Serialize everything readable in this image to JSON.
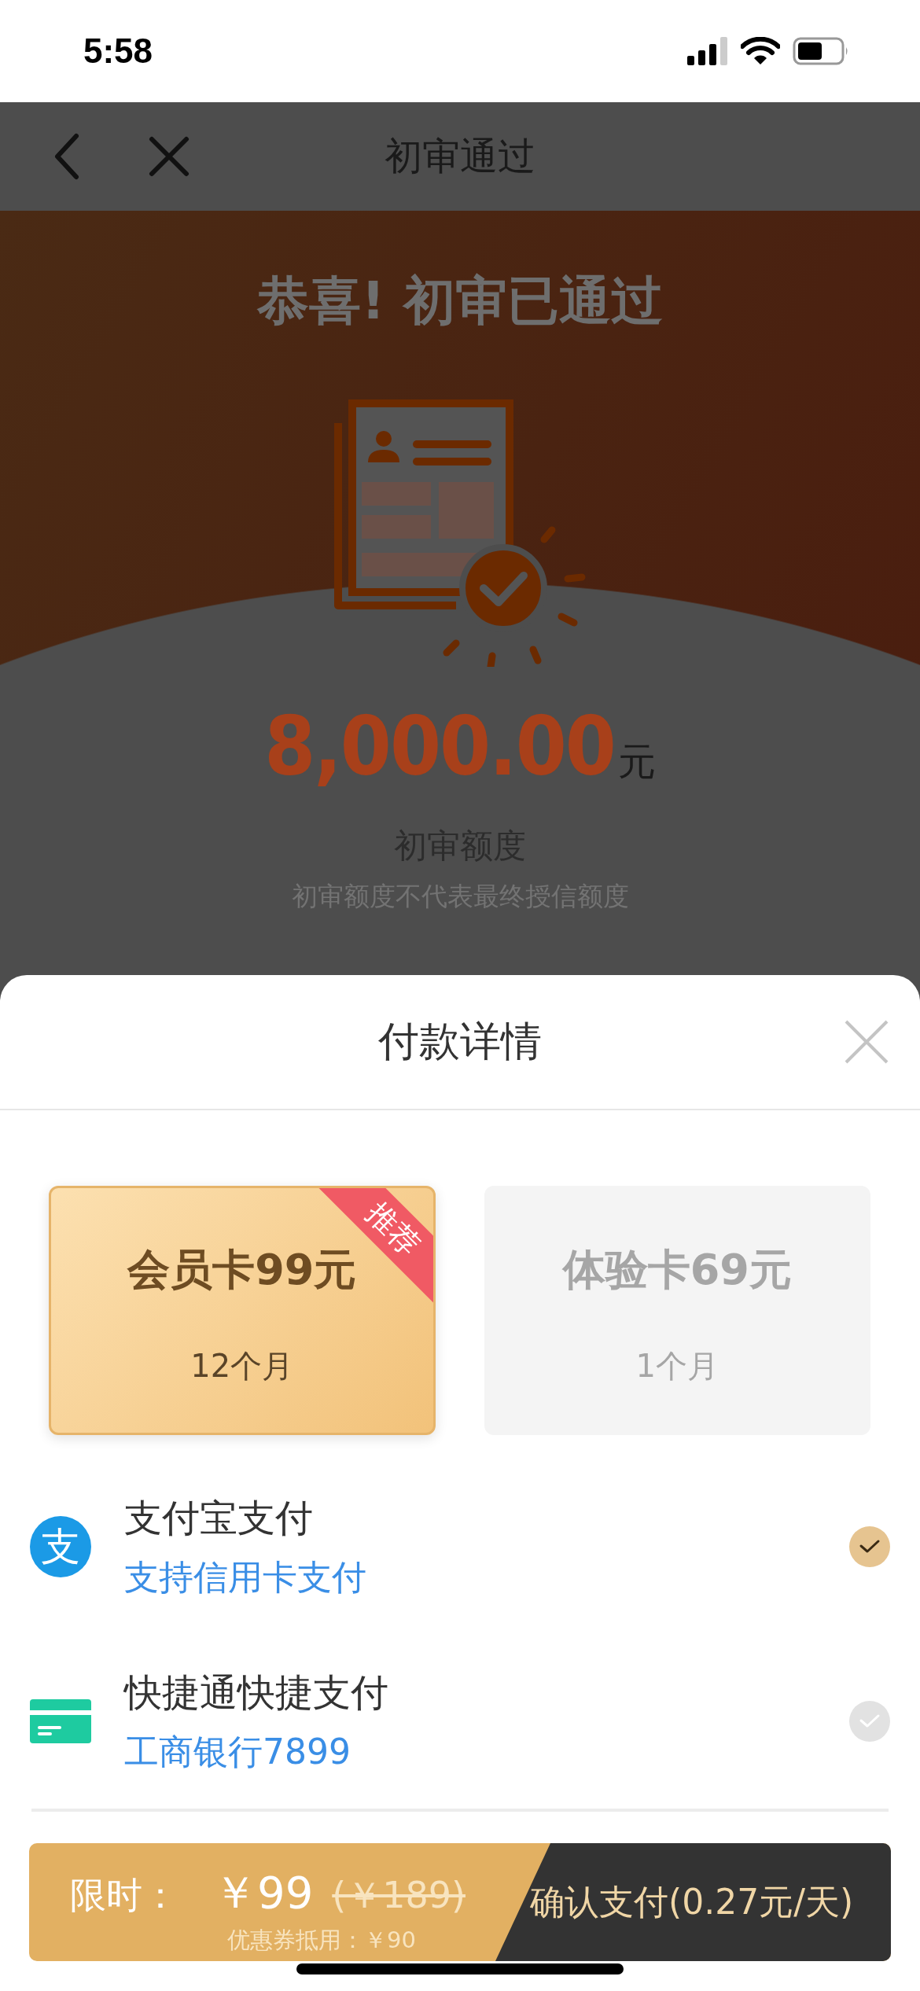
{
  "status_bar": {
    "time": "5:58"
  },
  "nav": {
    "title": "初审通过"
  },
  "hero": {
    "heading": "恭喜! 初审已通过",
    "amount": "8,000.00",
    "unit": "元",
    "label": "初审额度",
    "note": "初审额度不代表最终授信额度"
  },
  "sheet": {
    "title": "付款详情",
    "plans": [
      {
        "name": "会员卡99元",
        "period": "12个月",
        "selected": true,
        "badge": "推荐"
      },
      {
        "name": "体验卡69元",
        "period": "1个月",
        "selected": false
      }
    ],
    "payment_methods": [
      {
        "kind": "alipay",
        "logo_text": "支",
        "name": "支付宝支付",
        "detail": "支持信用卡支付",
        "selected": true
      },
      {
        "kind": "card",
        "name": "快捷通快捷支付",
        "detail": "工商银行7899",
        "selected": false
      }
    ]
  },
  "pay_bar": {
    "label": "限时：",
    "price": "￥99",
    "original_price": "(￥189)",
    "coupon": "优惠券抵用：￥90",
    "button": "确认支付(0.27元/天)"
  }
}
